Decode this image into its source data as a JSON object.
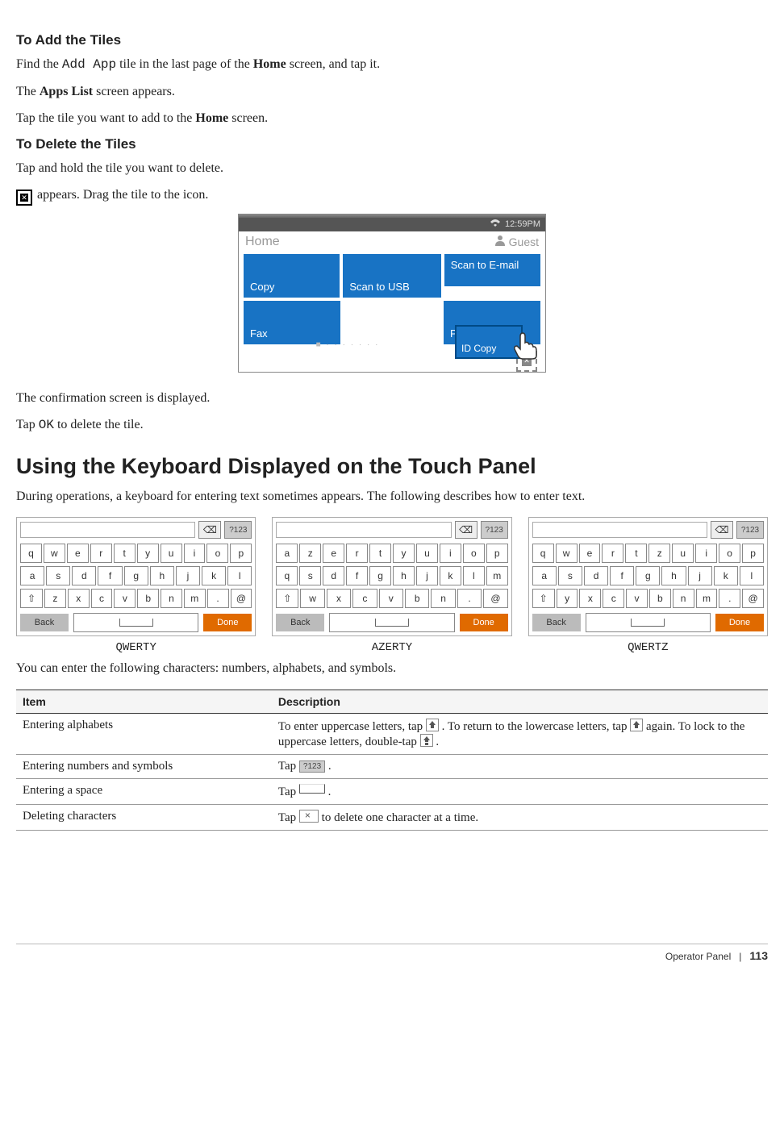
{
  "sections": {
    "add_tiles": {
      "heading": "To Add the Tiles",
      "p1_a": "Find the ",
      "p1_code": "Add App",
      "p1_b": " tile in the last page of the ",
      "p1_bold1": "Home",
      "p1_c": " screen, and tap it.",
      "p2_a": "The ",
      "p2_bold": "Apps List",
      "p2_b": " screen appears.",
      "p3_a": "Tap the tile you want to add to the ",
      "p3_bold": "Home",
      "p3_b": " screen."
    },
    "delete_tiles": {
      "heading": "To Delete the Tiles",
      "p1": "Tap and hold the tile you want to delete.",
      "p2_after_icon": " appears. Drag the tile to the icon.",
      "p3": "The confirmation screen is displayed.",
      "p4_a": "Tap ",
      "p4_code": "OK",
      "p4_b": " to delete the tile."
    },
    "keyboard": {
      "heading": "Using the Keyboard Displayed on the Touch Panel",
      "intro": "During operations, a keyboard for entering text sometimes appears. The following describes how to enter text.",
      "after_kb_note": "You can enter the following characters: numbers, alphabets, and symbols."
    }
  },
  "device": {
    "time": "12:59PM",
    "screen_label": "Home",
    "user": "Guest",
    "tiles": {
      "copy": "Copy",
      "scan_usb": "Scan to USB",
      "scan_email": "Scan to E-mail",
      "fax": "Fax",
      "print": "Print",
      "float": "ID Copy"
    }
  },
  "keyboards": {
    "qwerty": {
      "label": "QWERTY",
      "num_toggle": "?123",
      "r1": [
        "q",
        "w",
        "e",
        "r",
        "t",
        "y",
        "u",
        "i",
        "o",
        "p"
      ],
      "r2": [
        "a",
        "s",
        "d",
        "f",
        "g",
        "h",
        "j",
        "k",
        "l"
      ],
      "r3": [
        "z",
        "x",
        "c",
        "v",
        "b",
        "n",
        "m",
        ".",
        "@"
      ],
      "back": "Back",
      "done": "Done"
    },
    "azerty": {
      "label": "AZERTY",
      "num_toggle": "?123",
      "r1": [
        "a",
        "z",
        "e",
        "r",
        "t",
        "y",
        "u",
        "i",
        "o",
        "p"
      ],
      "r2": [
        "q",
        "s",
        "d",
        "f",
        "g",
        "h",
        "j",
        "k",
        "l",
        "m"
      ],
      "r3": [
        "w",
        "x",
        "c",
        "v",
        "b",
        "n",
        ".",
        "@"
      ],
      "back": "Back",
      "done": "Done"
    },
    "qwertz": {
      "label": "QWERTZ",
      "num_toggle": "?123",
      "r1": [
        "q",
        "w",
        "e",
        "r",
        "t",
        "z",
        "u",
        "i",
        "o",
        "p"
      ],
      "r2": [
        "a",
        "s",
        "d",
        "f",
        "g",
        "h",
        "j",
        "k",
        "l"
      ],
      "r3": [
        "y",
        "x",
        "c",
        "v",
        "b",
        "n",
        "m",
        ".",
        "@"
      ],
      "back": "Back",
      "done": "Done"
    }
  },
  "table": {
    "head_item": "Item",
    "head_desc": "Description",
    "rows": {
      "alpha_item": "Entering alphabets",
      "alpha_desc_a": "To enter uppercase letters, tap ",
      "alpha_desc_b": " . To return to the lowercase letters, tap ",
      "alpha_desc_c": " again. To lock to the uppercase letters, double-tap ",
      "alpha_desc_d": " .",
      "num_item": "Entering numbers and symbols",
      "num_desc_a": "Tap ",
      "num_icon_text": "?123",
      "num_desc_b": " .",
      "space_item": "Entering a space",
      "space_desc_a": "Tap ",
      "space_desc_b": " .",
      "del_item": "Deleting characters",
      "del_desc_a": "Tap ",
      "del_desc_b": " to delete one character at a time."
    }
  },
  "footer": {
    "chapter": "Operator Panel",
    "sep": "|",
    "page": "113"
  }
}
